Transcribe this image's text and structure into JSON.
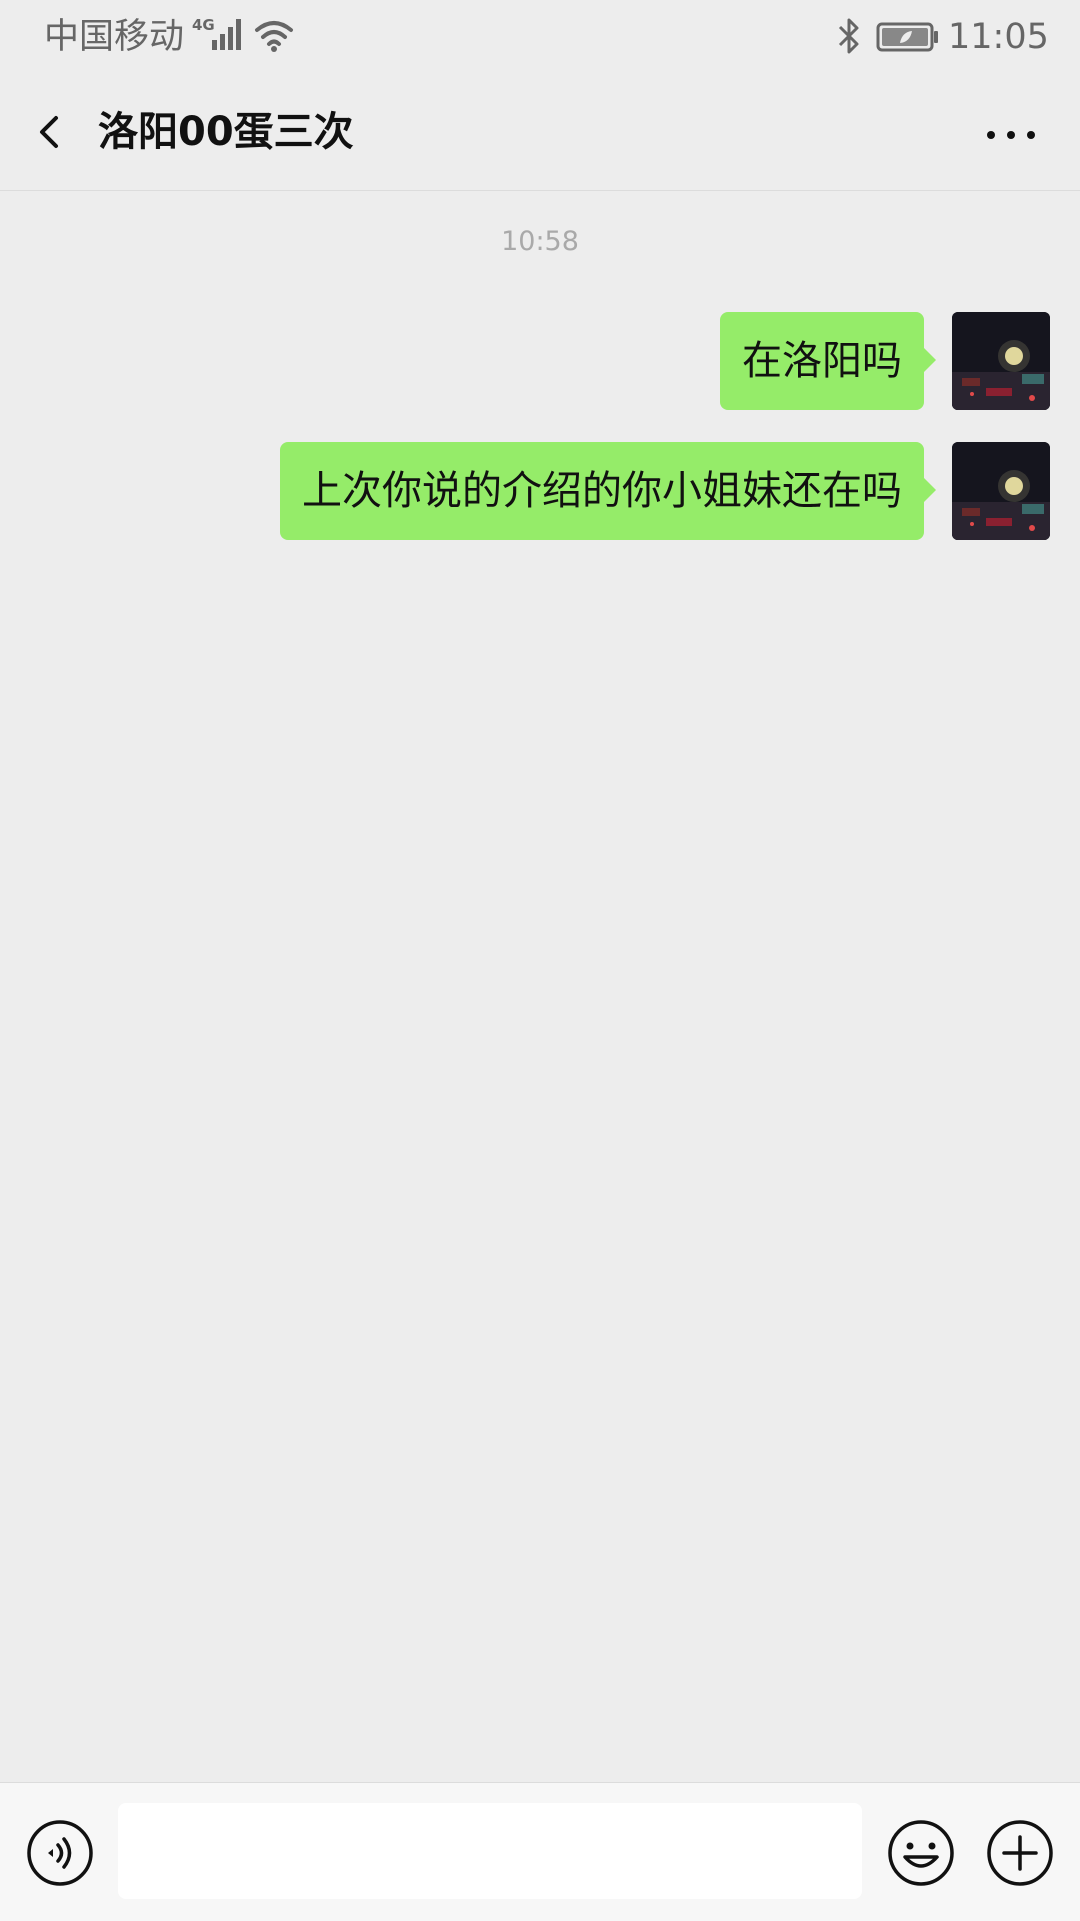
{
  "status_bar": {
    "carrier": "中国移动",
    "network_type": "4G",
    "time": "11:05",
    "icons": [
      "signal-icon",
      "wifi-icon",
      "bluetooth-icon",
      "battery-icon"
    ]
  },
  "header": {
    "back_icon": "chevron-left-icon",
    "title": "洛阳00蛋三次",
    "more_icon": "ellipsis-icon"
  },
  "chat": {
    "timestamp": "10:58",
    "messages": [
      {
        "direction": "sent",
        "text": "在洛阳吗"
      },
      {
        "direction": "sent",
        "text": "上次你说的介绍的你小姐妹还在吗"
      }
    ]
  },
  "input_bar": {
    "voice_icon": "voice-icon",
    "input_value": "",
    "emoji_icon": "emoji-icon",
    "plus_icon": "plus-icon"
  },
  "colors": {
    "background": "#ededed",
    "bubble_sent": "#95ec69",
    "timestamp": "#a9a9a9",
    "status_text": "#666666"
  }
}
